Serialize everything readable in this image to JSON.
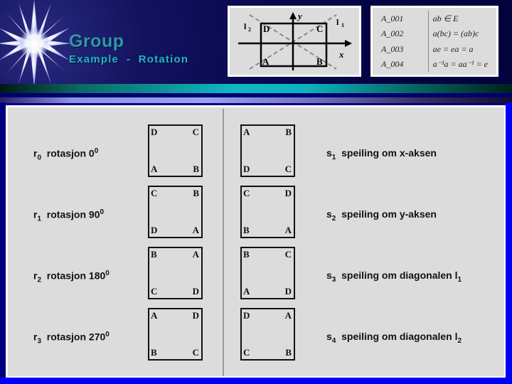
{
  "header": {
    "title_main": "Group",
    "title_sub": "Example  -  Rotation",
    "starburst_icon": "starburst-icon"
  },
  "axes_diagram": {
    "x_axis_label": "x",
    "y_axis_label": "y",
    "diagonal_1_label": "l1",
    "diagonal_2_label": "l2",
    "corner_top_left": "D",
    "corner_top_right": "C",
    "corner_bottom_left": "A",
    "corner_bottom_right": "B"
  },
  "axioms": [
    {
      "id": "A_001",
      "statement": "ab ∈ E"
    },
    {
      "id": "A_002",
      "statement": "a(bc) = (ab)c"
    },
    {
      "id": "A_003",
      "statement": "ae = ea = a"
    },
    {
      "id": "A_004",
      "statement": "a⁻¹a = aa⁻¹ = e"
    }
  ],
  "rotations": [
    {
      "symbol": "r",
      "index": "0",
      "text": "rotasjon 0",
      "degree": "0",
      "square": {
        "tl": "D",
        "tr": "C",
        "bl": "A",
        "br": "B"
      }
    },
    {
      "symbol": "r",
      "index": "1",
      "text": "rotasjon 90",
      "degree": "0",
      "square": {
        "tl": "C",
        "tr": "B",
        "bl": "D",
        "br": "A"
      }
    },
    {
      "symbol": "r",
      "index": "2",
      "text": "rotasjon 180",
      "degree": "0",
      "square": {
        "tl": "B",
        "tr": "A",
        "bl": "C",
        "br": "D"
      }
    },
    {
      "symbol": "r",
      "index": "3",
      "text": "rotasjon 270",
      "degree": "0",
      "square": {
        "tl": "A",
        "tr": "D",
        "bl": "B",
        "br": "C"
      }
    }
  ],
  "reflections": [
    {
      "symbol": "s",
      "index": "1",
      "text": "speiling om x-aksen",
      "line_index": "",
      "square": {
        "tl": "A",
        "tr": "B",
        "bl": "D",
        "br": "C"
      }
    },
    {
      "symbol": "s",
      "index": "2",
      "text": "speiling om y-aksen",
      "line_index": "",
      "square": {
        "tl": "C",
        "tr": "D",
        "bl": "B",
        "br": "A"
      }
    },
    {
      "symbol": "s",
      "index": "3",
      "text": "speiling om diagonalen l",
      "line_index": "1",
      "square": {
        "tl": "B",
        "tr": "C",
        "bl": "A",
        "br": "D"
      }
    },
    {
      "symbol": "s",
      "index": "4",
      "text": "speiling om diagonalen l",
      "line_index": "2",
      "square": {
        "tl": "D",
        "tr": "A",
        "bl": "C",
        "br": "B"
      }
    }
  ],
  "colors": {
    "background": "#00007e",
    "panel": "#dcdcdc",
    "title_main": "#2f97a6",
    "title_sub": "#21b6c4",
    "accent_blue": "#0000ff",
    "rule_teal": "#0fb8c4",
    "rule_violet": "#9aa0f2"
  }
}
